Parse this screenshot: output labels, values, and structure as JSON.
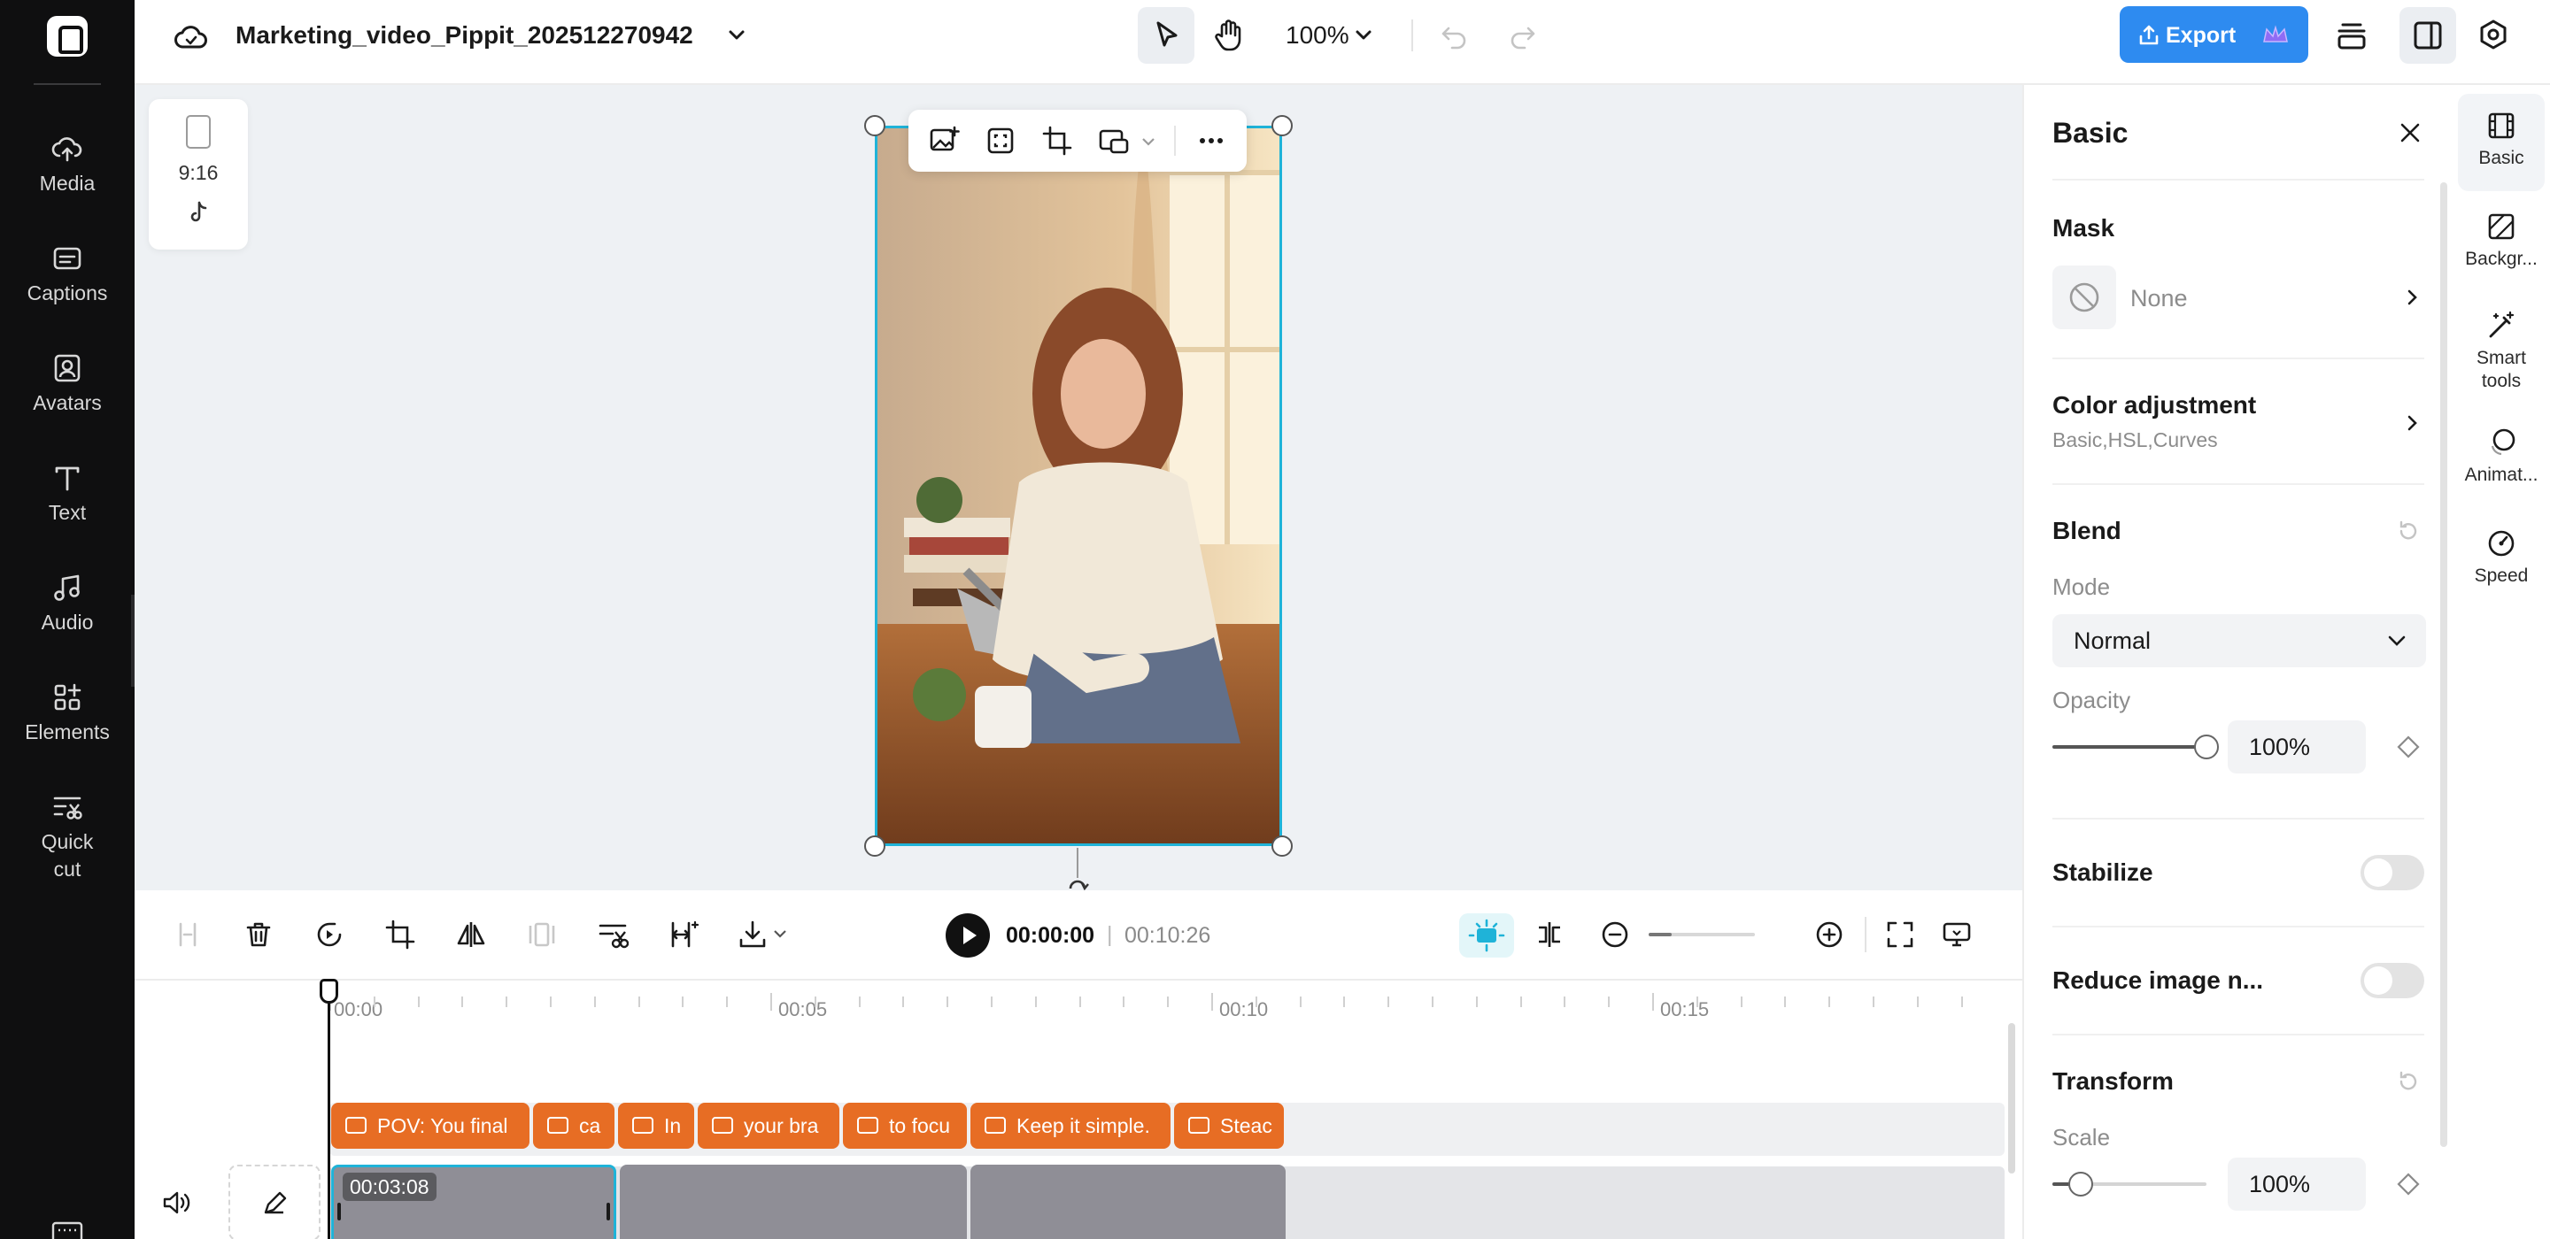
{
  "rail": {
    "items": [
      {
        "label": "Media",
        "icon": "cloud-upload-icon"
      },
      {
        "label": "Captions",
        "icon": "captions-icon"
      },
      {
        "label": "Avatars",
        "icon": "avatar-icon"
      },
      {
        "label": "Text",
        "icon": "text-icon"
      },
      {
        "label": "Audio",
        "icon": "music-note-icon"
      },
      {
        "label": "Elements",
        "icon": "elements-icon"
      },
      {
        "label": "Quick\ncut",
        "icon": "quick-cut-icon"
      }
    ]
  },
  "header": {
    "project_title": "Marketing_video_Pippit_202512270942",
    "zoom": "100%",
    "export_label": "Export"
  },
  "canvas": {
    "aspect_ratio": "9:16"
  },
  "playback": {
    "current_time": "00:00:00",
    "separator": "|",
    "total_time": "00:10:26"
  },
  "timeline": {
    "ruler": [
      "00:00",
      "00:05",
      "00:10",
      "00:15"
    ],
    "captions": [
      "POV: You final",
      "ca",
      "In",
      "your bra",
      "to focu",
      "Keep it simple.",
      "Steac"
    ],
    "clip_time": "00:03:08"
  },
  "panel": {
    "title": "Basic",
    "mask_label": "Mask",
    "mask_value": "None",
    "color_adjustment_label": "Color adjustment",
    "color_adjustment_sub": "Basic,HSL,Curves",
    "blend_label": "Blend",
    "mode_label": "Mode",
    "mode_value": "Normal",
    "opacity_label": "Opacity",
    "opacity_value": "100%",
    "stabilize_label": "Stabilize",
    "reduce_noise_label": "Reduce image n...",
    "transform_label": "Transform",
    "scale_label": "Scale",
    "scale_value": "100%"
  },
  "tabs": [
    {
      "label": "Basic"
    },
    {
      "label": "Backgr..."
    },
    {
      "label": "Smart\ntools"
    },
    {
      "label": "Animat..."
    },
    {
      "label": "Speed"
    }
  ],
  "colors": {
    "accent": "#2e8bf0",
    "selection": "#1fb3d8",
    "caption": "#e76d24",
    "rail": "#0f0f10"
  }
}
